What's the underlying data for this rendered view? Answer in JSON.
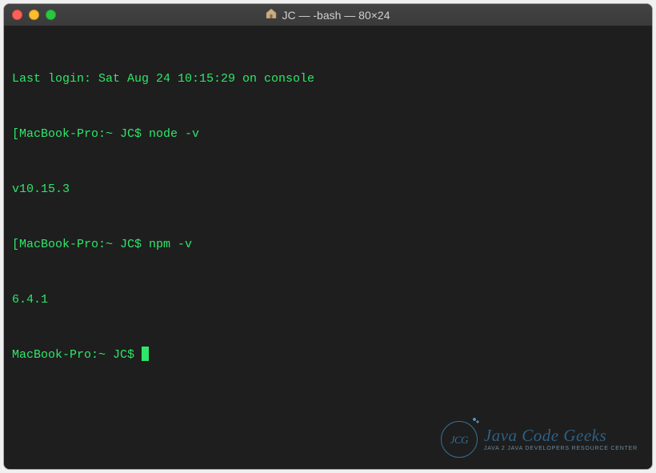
{
  "window": {
    "title": "JC — -bash — 80×24",
    "icon_name": "home-folder-icon"
  },
  "terminal": {
    "lines": [
      "Last login: Sat Aug 24 10:15:29 on console",
      "[MacBook-Pro:~ JC$ node -v",
      "v10.15.3",
      "[MacBook-Pro:~ JC$ npm -v",
      "6.4.1",
      "MacBook-Pro:~ JC$ "
    ]
  },
  "watermark": {
    "badge": "JCG",
    "main": "Java Code Geeks",
    "sub": "Java 2 Java Developers Resource Center"
  }
}
